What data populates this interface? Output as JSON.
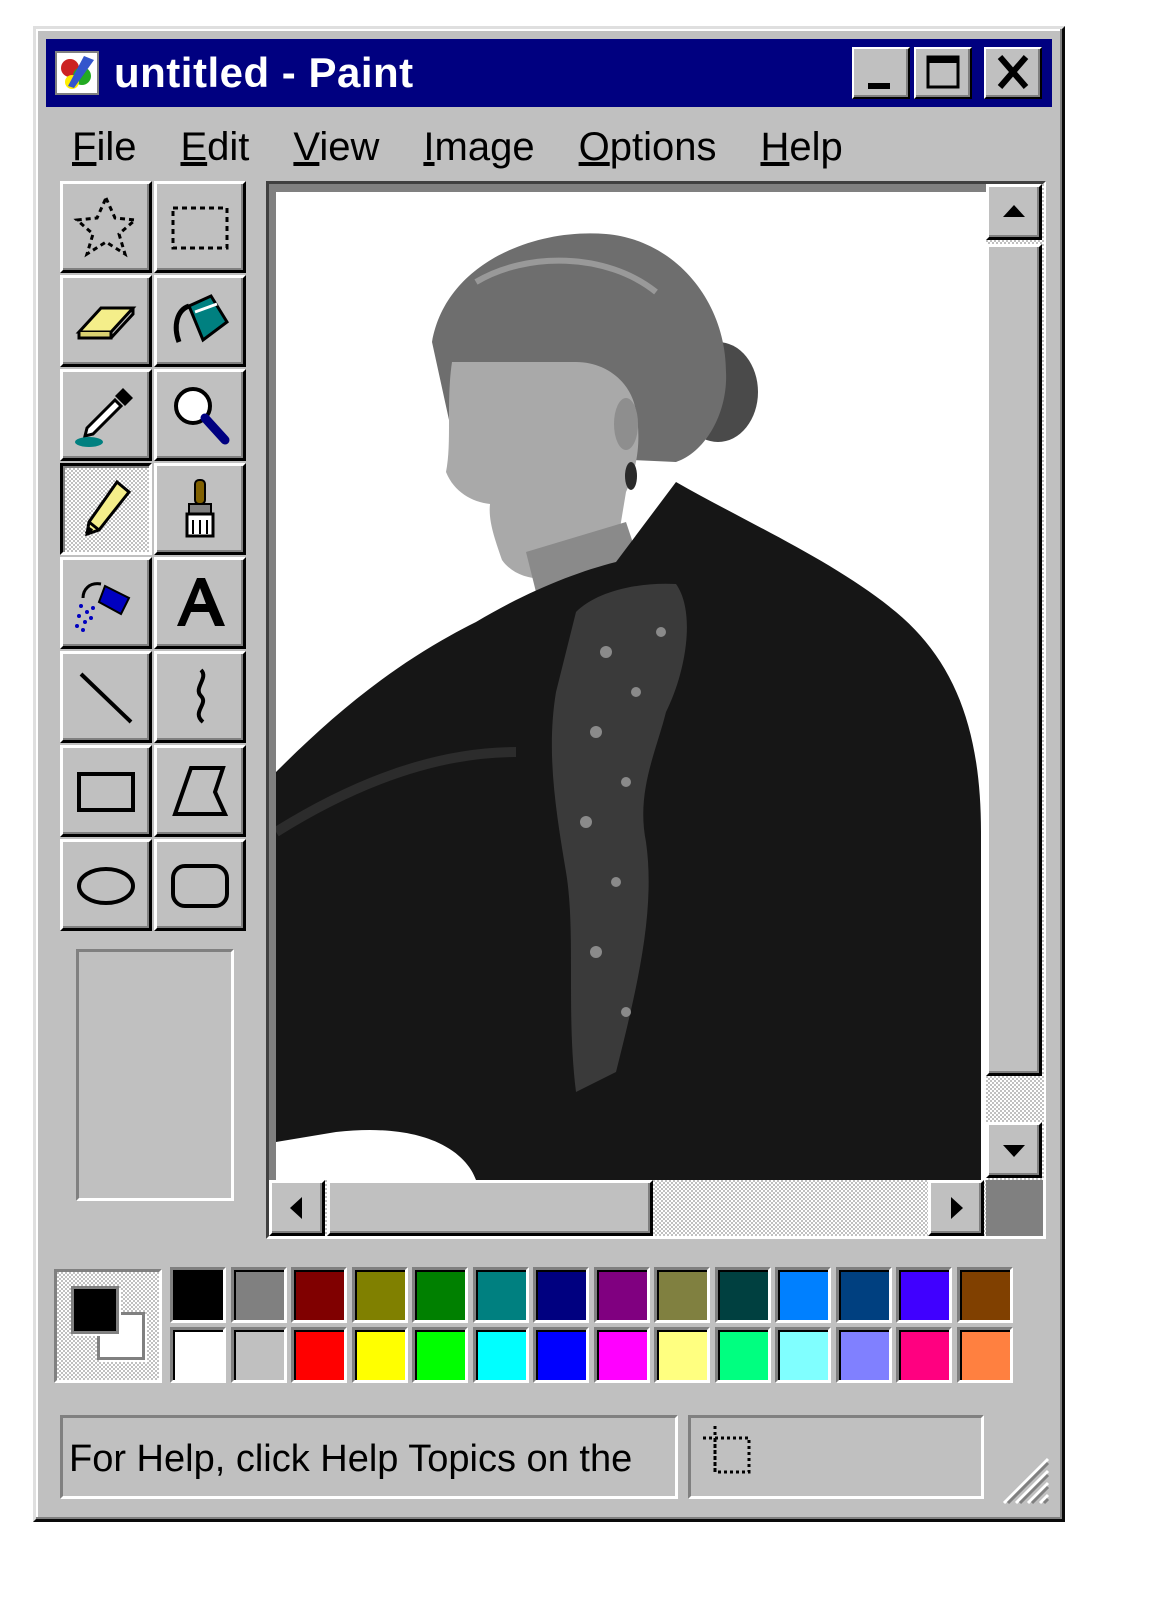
{
  "window": {
    "title": "untitled - Paint",
    "minimize_label": "minimize",
    "maximize_label": "maximize",
    "close_label": "close"
  },
  "menu": [
    {
      "key": "F",
      "rest": "ile"
    },
    {
      "key": "E",
      "rest": "dit"
    },
    {
      "key": "V",
      "rest": "iew"
    },
    {
      "key": "I",
      "rest": "mage"
    },
    {
      "key": "O",
      "rest": "ptions"
    },
    {
      "key": "H",
      "rest": "elp"
    }
  ],
  "tools": [
    {
      "name": "free-form-select-icon"
    },
    {
      "name": "rect-select-icon"
    },
    {
      "name": "eraser-icon"
    },
    {
      "name": "fill-bucket-icon"
    },
    {
      "name": "color-picker-icon"
    },
    {
      "name": "magnifier-icon"
    },
    {
      "name": "pencil-icon",
      "active": true
    },
    {
      "name": "brush-icon"
    },
    {
      "name": "airbrush-icon"
    },
    {
      "name": "text-icon",
      "glyph": "A"
    },
    {
      "name": "line-icon"
    },
    {
      "name": "curve-icon"
    },
    {
      "name": "rectangle-icon"
    },
    {
      "name": "polygon-icon"
    },
    {
      "name": "ellipse-icon"
    },
    {
      "name": "rounded-rect-icon"
    }
  ],
  "colors": {
    "title_bar": "#000080",
    "chrome": "#c0c0c0",
    "foreground": "#000000",
    "background": "#ffffff"
  },
  "palette": {
    "top": [
      "#000000",
      "#808080",
      "#800000",
      "#808000",
      "#008000",
      "#008080",
      "#000080",
      "#800080",
      "#808040",
      "#004040",
      "#0080ff",
      "#004080",
      "#4000ff",
      "#804000"
    ],
    "bottom": [
      "#ffffff",
      "#c0c0c0",
      "#ff0000",
      "#ffff00",
      "#00ff00",
      "#00ffff",
      "#0000ff",
      "#ff00ff",
      "#ffff80",
      "#00ff80",
      "#80ffff",
      "#8080ff",
      "#ff0080",
      "#ff8040"
    ]
  },
  "canvas": {
    "content": "photo-portrait"
  },
  "status": {
    "help_text": "For Help, click Help Topics on the"
  }
}
